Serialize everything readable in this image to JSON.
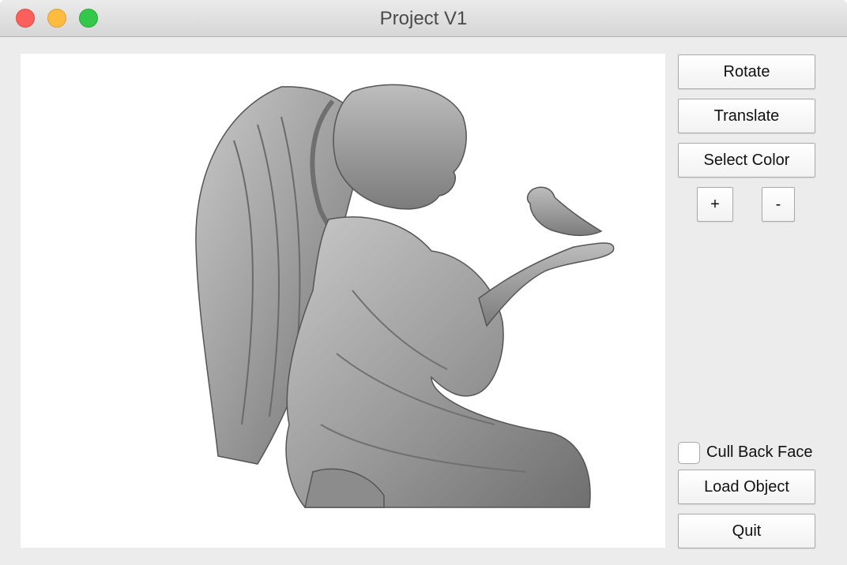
{
  "window": {
    "title": "Project V1"
  },
  "viewport": {
    "model": "angel-statue-with-bird"
  },
  "controls": {
    "rotate_label": "Rotate",
    "translate_label": "Translate",
    "select_color_label": "Select Color",
    "zoom_in_label": "+",
    "zoom_out_label": "-",
    "cull_back_face_label": "Cull Back Face",
    "cull_back_face_checked": false,
    "load_object_label": "Load Object",
    "quit_label": "Quit"
  },
  "colors": {
    "close": "#fc605c",
    "minimize": "#fdbc40",
    "zoom": "#34c84a",
    "model_shade": "#9a9a9a"
  }
}
